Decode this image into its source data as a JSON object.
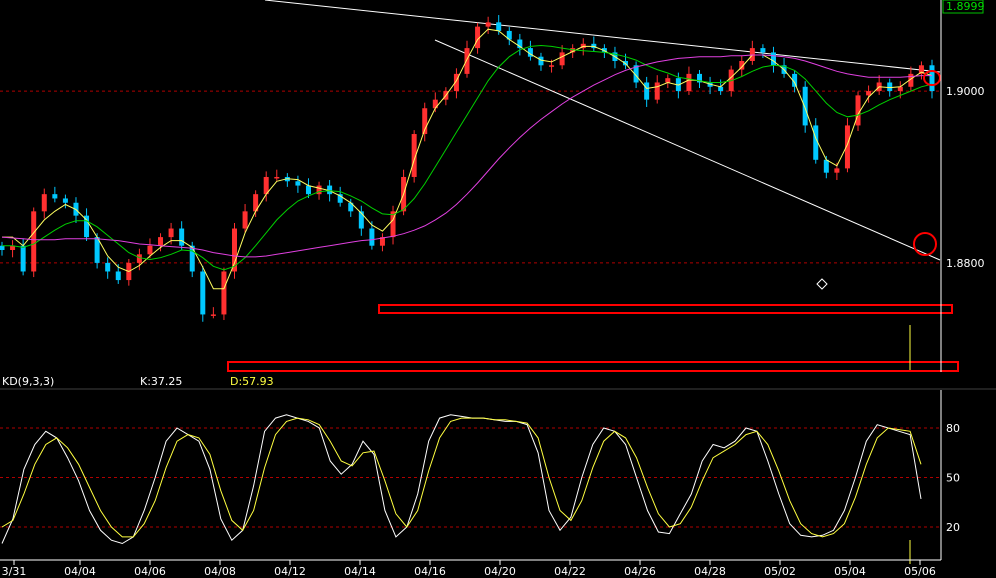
{
  "colors": {
    "background": "#000000",
    "candle_up": "#ff3030",
    "candle_down": "#00c8ff",
    "ma_fast": "#ffff60",
    "ma_mid": "#00d000",
    "ma_slow": "#e040e0",
    "grid": "#b00000",
    "trendline": "#ffffff",
    "highlight": "#ff0000",
    "k_line": "#ffffff",
    "d_line": "#ffff40",
    "current_price_box": "#00c000"
  },
  "chart_data": [
    {
      "type": "candlestick",
      "title": "",
      "y_ticks": [
        "1.8800",
        "1.9000"
      ],
      "y_tick_values": [
        1.88,
        1.9
      ],
      "current_price_label": "1.8999",
      "current_price": 1.8999,
      "ylim": [
        1.8673,
        1.9106
      ],
      "x_tick_labels": [
        "3/31",
        "04/04",
        "04/06",
        "04/08",
        "04/12",
        "04/14",
        "04/16",
        "04/20",
        "04/22",
        "04/26",
        "04/28",
        "05/02",
        "05/04",
        "05/06"
      ],
      "series": [
        {
          "name": "price",
          "kind": "close",
          "values": [
            1.8815,
            1.882,
            1.879,
            1.886,
            1.888,
            1.8875,
            1.887,
            1.8855,
            1.883,
            1.88,
            1.879,
            1.878,
            1.88,
            1.881,
            1.882,
            1.883,
            1.884,
            1.882,
            1.879,
            1.874,
            1.874,
            1.879,
            1.884,
            1.886,
            1.888,
            1.89,
            1.89,
            1.8895,
            1.889,
            1.888,
            1.889,
            1.888,
            1.887,
            1.886,
            1.884,
            1.882,
            1.883,
            1.886,
            1.89,
            1.895,
            1.898,
            1.899,
            1.9,
            1.902,
            1.905,
            1.9075,
            1.908,
            1.907,
            1.906,
            1.905,
            1.904,
            1.903,
            1.903,
            1.9045,
            1.905,
            1.9055,
            1.905,
            1.9045,
            1.9035,
            1.903,
            1.901,
            1.899,
            1.901,
            1.9015,
            1.9,
            1.902,
            1.901,
            1.9005,
            1.9,
            1.9025,
            1.9035,
            1.905,
            1.9045,
            1.903,
            1.902,
            1.9005,
            1.896,
            1.892,
            1.8905,
            1.891,
            1.896,
            1.8995,
            1.9,
            1.901,
            1.9,
            1.9005,
            1.902,
            1.903,
            1.9
          ]
        },
        {
          "name": "",
          "kind": "ma",
          "values": [
            1.883,
            1.883,
            1.882,
            1.8835,
            1.885,
            1.886,
            1.8868,
            1.8862,
            1.885,
            1.883,
            1.8808,
            1.8795,
            1.879,
            1.8797,
            1.8808,
            1.8818,
            1.8826,
            1.8826,
            1.8818,
            1.8795,
            1.877,
            1.877,
            1.88,
            1.8835,
            1.886,
            1.888,
            1.8895,
            1.8898,
            1.8897,
            1.889,
            1.8887,
            1.8884,
            1.8878,
            1.887,
            1.8858,
            1.8844,
            1.8837,
            1.885,
            1.888,
            1.892,
            1.8955,
            1.898,
            1.8995,
            1.9012,
            1.9037,
            1.906,
            1.9072,
            1.907,
            1.906,
            1.9052,
            1.9043,
            1.9036,
            1.9034,
            1.904,
            1.9046,
            1.9052,
            1.9052,
            1.9047,
            1.904,
            1.9032,
            1.9018,
            1.9003,
            1.9005,
            1.901,
            1.9007,
            1.9013,
            1.9012,
            1.9008,
            1.9005,
            1.9016,
            1.9028,
            1.9042,
            1.9042,
            1.9035,
            1.9025,
            1.901,
            1.898,
            1.8945,
            1.892,
            1.8913,
            1.8938,
            1.8973,
            1.8993,
            1.9005,
            1.9004,
            1.9005,
            1.9014,
            1.9022,
            1.9018
          ]
        },
        {
          "name": "",
          "kind": "ma",
          "values": [
            1.882,
            1.882,
            1.8818,
            1.8822,
            1.883,
            1.8838,
            1.8845,
            1.8849,
            1.8849,
            1.8842,
            1.8832,
            1.8822,
            1.8812,
            1.8806,
            1.8804,
            1.8806,
            1.881,
            1.8815,
            1.8814,
            1.8806,
            1.8796,
            1.8792,
            1.8796,
            1.8806,
            1.882,
            1.8835,
            1.885,
            1.8862,
            1.8872,
            1.8878,
            1.8883,
            1.8884,
            1.8883,
            1.8878,
            1.8872,
            1.8864,
            1.8857,
            1.8856,
            1.8862,
            1.8875,
            1.8892,
            1.8912,
            1.8932,
            1.8952,
            1.8972,
            1.8992,
            1.9012,
            1.9028,
            1.904,
            1.9048,
            1.9052,
            1.9053,
            1.9052,
            1.905,
            1.9048,
            1.9047,
            1.9046,
            1.9045,
            1.9043,
            1.904,
            1.9036,
            1.903,
            1.9025,
            1.9021,
            1.9016,
            1.9014,
            1.9012,
            1.901,
            1.901,
            1.9012,
            1.9017,
            1.9023,
            1.9028,
            1.903,
            1.9029,
            1.9024,
            1.9014,
            1.9,
            1.8986,
            1.8975,
            1.897,
            1.8972,
            1.8977,
            1.8984,
            1.899,
            1.8995,
            1.9,
            1.9005,
            1.9008
          ]
        },
        {
          "name": "",
          "kind": "ma",
          "values": [
            1.883,
            1.8829,
            1.8828,
            1.8827,
            1.8827,
            1.8827,
            1.8828,
            1.8828,
            1.8828,
            1.8828,
            1.8827,
            1.8826,
            1.8824,
            1.8822,
            1.8821,
            1.882,
            1.8819,
            1.8818,
            1.8817,
            1.8815,
            1.8812,
            1.881,
            1.8808,
            1.8807,
            1.8807,
            1.8808,
            1.881,
            1.8812,
            1.8814,
            1.8816,
            1.8818,
            1.882,
            1.8822,
            1.8824,
            1.8826,
            1.8827,
            1.8829,
            1.8831,
            1.8834,
            1.8838,
            1.8843,
            1.885,
            1.8858,
            1.8868,
            1.888,
            1.8893,
            1.8907,
            1.8921,
            1.8934,
            1.8946,
            1.8957,
            1.8967,
            1.8976,
            1.8985,
            1.8993,
            1.9,
            1.9007,
            1.9013,
            1.9019,
            1.9024,
            1.9028,
            1.9031,
            1.9034,
            1.9036,
            1.9038,
            1.9039,
            1.904,
            1.904,
            1.904,
            1.9041,
            1.9041,
            1.9042,
            1.9042,
            1.9041,
            1.904,
            1.9038,
            1.9035,
            1.9031,
            1.9027,
            1.9023,
            1.902,
            1.9018,
            1.9016,
            1.9016,
            1.9016,
            1.9016,
            1.9017,
            1.9018,
            1.9018
          ]
        }
      ]
    },
    {
      "type": "line",
      "title": "KD(9,3,3)",
      "k_label": "K:37.25",
      "d_label": "D:57.93",
      "y_ticks": [
        "20",
        "50",
        "80"
      ],
      "y_tick_values": [
        20,
        50,
        80
      ],
      "ylim": [
        0,
        100
      ],
      "series": [
        {
          "name": "K",
          "values": [
            10,
            25,
            55,
            70,
            78,
            74,
            62,
            48,
            30,
            18,
            12,
            10,
            14,
            30,
            50,
            72,
            80,
            76,
            72,
            55,
            25,
            12,
            18,
            45,
            78,
            86,
            88,
            86,
            84,
            80,
            60,
            52,
            58,
            72,
            64,
            30,
            14,
            20,
            40,
            72,
            86,
            88,
            87,
            86,
            86,
            85,
            84,
            84,
            82,
            65,
            30,
            18,
            26,
            50,
            70,
            80,
            78,
            70,
            50,
            30,
            17,
            16,
            28,
            40,
            60,
            70,
            68,
            72,
            80,
            78,
            60,
            40,
            22,
            15,
            14,
            15,
            18,
            30,
            50,
            72,
            82,
            80,
            78,
            76,
            37
          ]
        },
        {
          "name": "D",
          "values": [
            20,
            24,
            40,
            58,
            70,
            74,
            68,
            58,
            44,
            30,
            20,
            14,
            14,
            22,
            36,
            56,
            72,
            76,
            74,
            64,
            42,
            24,
            18,
            30,
            56,
            76,
            84,
            86,
            85,
            82,
            72,
            60,
            57,
            65,
            66,
            48,
            28,
            20,
            30,
            54,
            74,
            84,
            86,
            86,
            86,
            85,
            85,
            84,
            83,
            74,
            50,
            30,
            24,
            36,
            56,
            72,
            78,
            74,
            62,
            44,
            28,
            20,
            22,
            32,
            48,
            62,
            66,
            70,
            76,
            78,
            70,
            54,
            36,
            22,
            16,
            14,
            16,
            22,
            38,
            58,
            74,
            80,
            79,
            78,
            58
          ]
        }
      ]
    }
  ]
}
